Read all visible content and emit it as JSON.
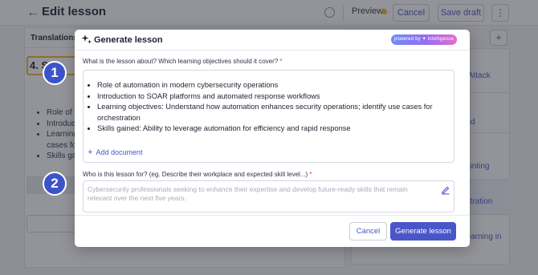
{
  "page": {
    "title": "Edit lesson",
    "preview_label": "Preview",
    "cancel_label": "Cancel",
    "save_draft_label": "Save draft",
    "more_label": "⋮",
    "accent_color": "#4a55c8"
  },
  "editor": {
    "tab_label": "Translations",
    "heading": "4. S",
    "bullets": [
      "Role of a",
      "Introduct",
      "Learning",
      "cases fo",
      "Skills gai"
    ]
  },
  "sidebar": {
    "add_label": "+",
    "items": [
      {
        "label": "d Attack"
      },
      {
        "label": "and"
      },
      {
        "label": "Hunting"
      },
      {
        "label": "estration"
      },
      {
        "label": "Learning in"
      }
    ]
  },
  "modal": {
    "title": "Generate lesson",
    "badge": "powered by ✦ intelligence",
    "question1": "What is the lesson about? Which learning objectives should it cover?",
    "question2": "Who is this lesson for? (eg. Describe their workplace and expected skill level...)",
    "required_mark": "*",
    "answer_items": [
      "Role of automation in modern cybersecurity operations",
      "Introduction to SOAR platforms and automated response workflows",
      "Learning objectives: Understand how automation enhances security operations; identify use cases for orchestration",
      "Skills gained: Ability to leverage automation for efficiency and rapid response"
    ],
    "add_document": "Add document",
    "add_document_icon": "+",
    "audience_placeholder": "Cybersecurity professionals seeking to enhance their expertise and develop future-ready skills that remain relevant over the next five years.",
    "cancel_label": "Cancel",
    "generate_label": "Generate lesson"
  },
  "steps": [
    "1",
    "2"
  ],
  "icons": {
    "back": "arrow-left-icon",
    "help": "help-circle-icon",
    "sparkle": "sparkle-icon",
    "pencil": "pencil-icon"
  }
}
